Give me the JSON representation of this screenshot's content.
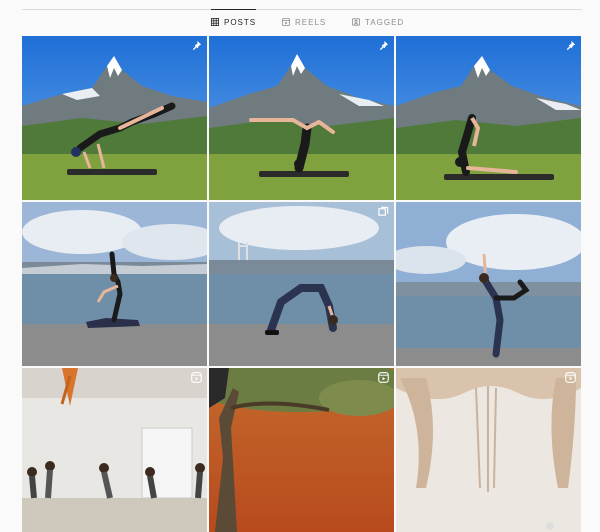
{
  "tabs": [
    {
      "label": "POSTS",
      "icon": "grid-icon",
      "active": true
    },
    {
      "label": "REELS",
      "icon": "reels-icon",
      "active": false
    },
    {
      "label": "TAGGED",
      "icon": "tagged-icon",
      "active": false
    }
  ],
  "posts": [
    {
      "scene": "mountain-pose-forearm-balance",
      "badge": "pin-icon"
    },
    {
      "scene": "mountain-pose-scorpion",
      "badge": "pin-icon"
    },
    {
      "scene": "mountain-pose-forearm-stand",
      "badge": "pin-icon"
    },
    {
      "scene": "bay-pose-kneeling",
      "badge": ""
    },
    {
      "scene": "bay-pose-wheel",
      "badge": "carousel-icon"
    },
    {
      "scene": "bay-pose-dancer",
      "badge": ""
    },
    {
      "scene": "studio-class",
      "badge": "reel-icon"
    },
    {
      "scene": "painted-tree-wall",
      "badge": "reel-icon"
    },
    {
      "scene": "macrame-wall",
      "badge": "reel-icon"
    }
  ],
  "colors": {
    "accent": "#262626",
    "muted": "#8e8e8e",
    "divider": "#dbdbdb"
  }
}
